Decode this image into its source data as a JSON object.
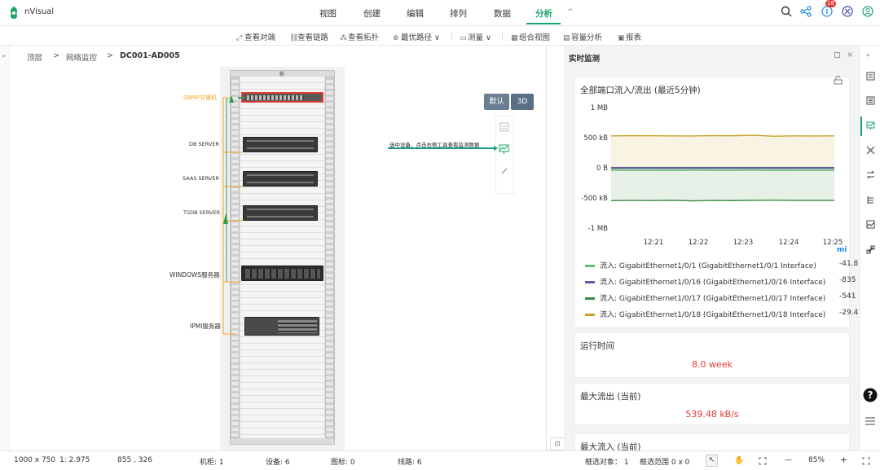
{
  "app": {
    "name": "nVisual"
  },
  "menu": [
    {
      "label": "视图",
      "active": false
    },
    {
      "label": "创建",
      "active": false
    },
    {
      "label": "编辑",
      "active": false
    },
    {
      "label": "排列",
      "active": false
    },
    {
      "label": "数据",
      "active": false
    },
    {
      "label": "分析",
      "active": true
    }
  ],
  "menu_collapse": "^",
  "notifications": {
    "count": "18"
  },
  "toolbar": [
    {
      "label": "查看对端",
      "icon": "link-diagonal-icon"
    },
    {
      "label": "查看链路",
      "icon": "chain-icon"
    },
    {
      "label": "查看拓扑",
      "icon": "topology-icon"
    },
    {
      "label": "最优路径 ∨",
      "icon": "path-icon"
    },
    {
      "label": "测量 ∨",
      "icon": "ruler-icon"
    },
    {
      "label": "组合视图",
      "icon": "combine-icon"
    },
    {
      "label": "容量分析",
      "icon": "capacity-icon"
    },
    {
      "label": "报表",
      "icon": "report-icon"
    }
  ],
  "breadcrumb": {
    "items": [
      "顶层",
      "网络监控",
      "DC001-AD005"
    ],
    "sep": ">"
  },
  "rack": {
    "top_label": "前",
    "devices": [
      {
        "label": "SNMP交换机",
        "highlight": true
      },
      {
        "label": "DB SERVER"
      },
      {
        "label": "SAAS SERVER"
      },
      {
        "label": "TSDB SERVER"
      },
      {
        "label": "WINDOWS服务器"
      },
      {
        "label": "IPMI服务器"
      }
    ]
  },
  "canvas": {
    "view_default": "默认",
    "view_3d": "3D",
    "hint": "选中设备，点击右侧工具查看监测数据"
  },
  "right_panel": {
    "title": "实时监测",
    "chart_card": {
      "title": "全部端口流入/流出 (最近5分钟)",
      "unit_label": "mi"
    },
    "uptime": {
      "title": "运行时间",
      "value": "8.0 week"
    },
    "max_out": {
      "title": "最大流出 (当前)",
      "value": "539.48 kB/s"
    },
    "max_in": {
      "title": "最大流入 (当前)"
    }
  },
  "chart_data": {
    "type": "line",
    "title": "全部端口流入/流出 (最近5分钟)",
    "y_ticks": [
      "1 MB",
      "500 kB",
      "0 B",
      "-500 kB",
      "-1 MB"
    ],
    "ylim": [
      -1000,
      1000
    ],
    "y_unit": "kB",
    "x_ticks": [
      "12:21",
      "12:22",
      "12:23",
      "12:24",
      "12:25"
    ],
    "x": [
      "12:20",
      "12:20:30",
      "12:21",
      "12:21:30",
      "12:22",
      "12:22:30",
      "12:23",
      "12:23:30",
      "12:24",
      "12:24:30",
      "12:25",
      "12:25:20"
    ],
    "series": [
      {
        "name": "流入: GigabitEthernet1/0/1 (GigabitEthernet1/0/1 Interface)",
        "color": "#6abf69",
        "last": "-41.8",
        "values": [
          -40,
          -42,
          -41,
          -43,
          -40,
          -42,
          -41,
          -40,
          -43,
          -42,
          -41,
          -42
        ]
      },
      {
        "name": "流入: GigabitEthernet1/0/16 (GigabitEthernet1/0/16 Interface)",
        "color": "#5b5fa8",
        "last": "-835",
        "values": [
          -1,
          -1,
          -1,
          -1,
          -1,
          -1,
          -1,
          -1,
          -1,
          -1,
          -1,
          -1
        ]
      },
      {
        "name": "流入: GigabitEthernet1/0/17 (GigabitEthernet1/0/17 Interface)",
        "color": "#3d8b3d",
        "last": "-541",
        "values": [
          -545,
          -542,
          -543,
          -540,
          -548,
          -541,
          -544,
          -540,
          -538,
          -542,
          -541,
          -541
        ]
      },
      {
        "name": "流入: GigabitEthernet1/0/18 (GigabitEthernet1/0/18 Interface)",
        "color": "#c9a227",
        "last": "-29.4",
        "values": [
          530,
          532,
          531,
          530,
          528,
          535,
          532,
          540,
          525,
          530,
          528,
          530
        ]
      }
    ],
    "fill": true,
    "grid": false,
    "legend": "bottom"
  },
  "statusbar": {
    "canvas_size": "1000 x 750",
    "scale": "1: 2.975",
    "coords": "855 , 326",
    "rack_count": "机柜: 1",
    "device_count": "设备: 6",
    "icon_count": "图标: 0",
    "line_count": "线路: 6",
    "selected": "框选对象： 1",
    "selected_range": "框选范围  0 x 0",
    "zoom": "85%",
    "minus": "—",
    "plus": "+"
  }
}
